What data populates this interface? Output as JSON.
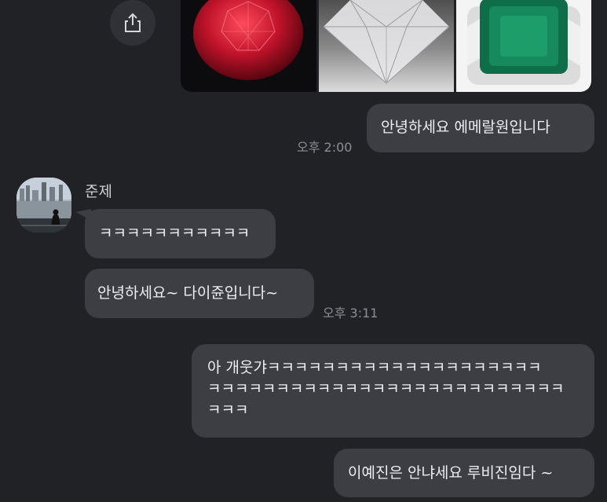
{
  "chat": {
    "share_icon": "share-icon",
    "photos": [
      "ruby",
      "diamond",
      "emerald-ring"
    ],
    "messages": [
      {
        "text": "안녕하세요 에메랄원입니다",
        "time": "오후 2:00"
      },
      {
        "sender": "준제",
        "text": "ㅋㅋㅋㅋㅋㅋㅋㅋㅋㅋㅋ"
      },
      {
        "text": "안녕하세요~ 다이쥰입니다~",
        "time": "오후 3:11"
      },
      {
        "lines": [
          "아 개웃갸ㅋㅋㅋㅋㅋㅋㅋㅋㅋㅋㅋㅋㅋㅋㅋㅋㅋㅋㅋㅋ",
          "ㅋㅋㅋㅋㅋㅋㅋㅋㅋㅋㅋㅋㅋㅋㅋㅋㅋㅋㅋㅋㅋㅋㅋㅋㅋㅋ",
          "ㅋㅋㅋ"
        ]
      },
      {
        "text": "이예진은 안냐세요 루비진임다 ~"
      }
    ]
  },
  "colors": {
    "background": "#212226",
    "bubble": "#3d3e44",
    "time": "#8d8e94"
  }
}
